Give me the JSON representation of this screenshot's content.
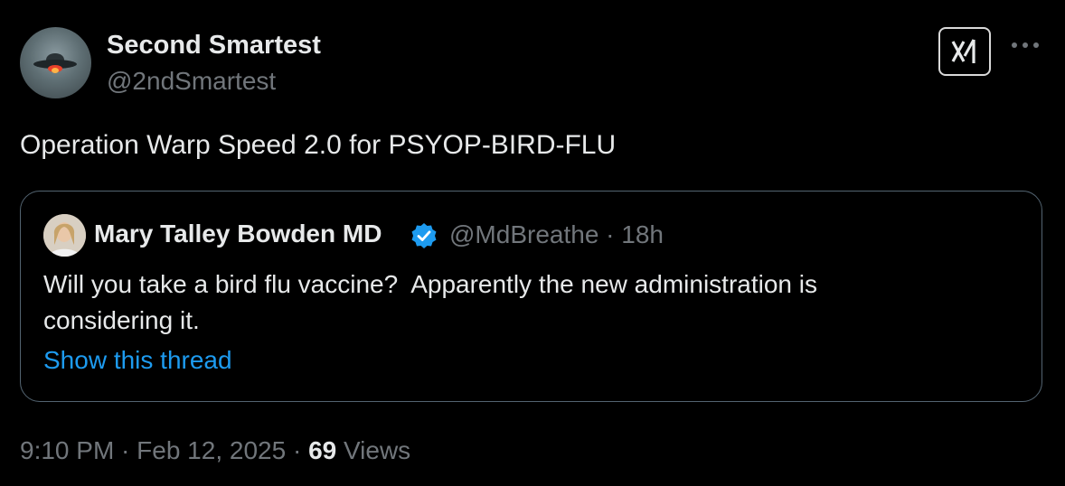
{
  "author": {
    "name": "Second Smartest",
    "handle": "@2ndSmartest",
    "avatar_icon": "ufo-avatar"
  },
  "tweet": {
    "text": "Operation Warp Speed 2.0 for PSYOP-BIRD-FLU"
  },
  "quote": {
    "name": "Mary Talley Bowden MD",
    "verified_icon": "verified-badge-icon",
    "handle_time": "@MdBreathe · 18h",
    "text_line1": "Will you take a bird flu vaccine?  Apparently the new administration is",
    "text_line2": "considering it.",
    "show_thread": "Show this thread"
  },
  "meta": {
    "time_date": "9:10 PM · Feb 12, 2025 · ",
    "views_count": "69",
    "views_label": " Views"
  },
  "colors": {
    "background": "#000000",
    "text_primary": "#e7e9ea",
    "text_secondary": "#71767b",
    "link": "#1d9bf0",
    "border": "#536471"
  },
  "icons": {
    "grok": "grok-icon",
    "more": "more-dots-icon"
  }
}
